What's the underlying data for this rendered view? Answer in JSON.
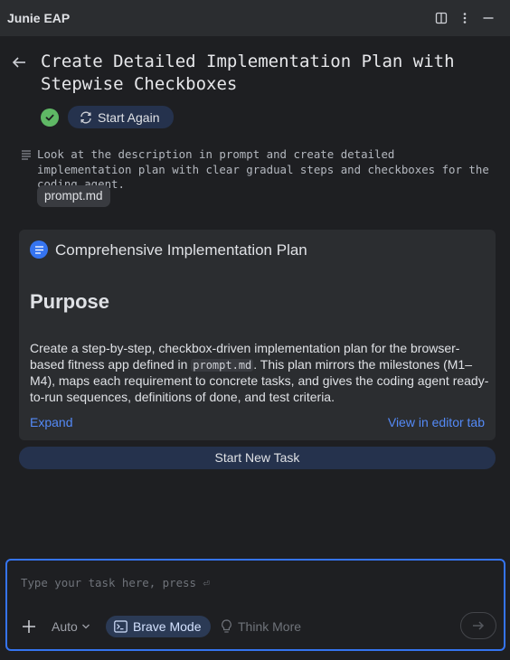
{
  "window": {
    "title": "Junie EAP",
    "icons": [
      "split-panel-icon",
      "more-vertical-icon",
      "minimize-icon"
    ]
  },
  "task": {
    "title": "Create Detailed Implementation Plan with Stepwise Checkboxes",
    "status_icon": "check-circle-icon",
    "start_again_label": "Start Again",
    "prompt_text": "Look at the description in prompt and create detailed implementation plan with clear gradual steps and checkboxes for the coding agent.",
    "attachment": "prompt.md"
  },
  "plan": {
    "title": "Comprehensive Implementation Plan",
    "heading": "Purpose",
    "body_before": "Create a step-by-step, checkbox-driven implementation plan for the browser-based fitness app defined in ",
    "body_code": "prompt.md",
    "body_after": ". This plan mirrors the milestones (M1–M4), maps each requirement to concrete tasks, and gives the coding agent ready-to-run sequences, definitions of done, and test criteria.",
    "expand_label": "Expand",
    "view_label": "View in editor tab"
  },
  "actions": {
    "new_task_label": "Start New Task"
  },
  "composer": {
    "placeholder": "Type your task here, press ⏎",
    "model": "Auto",
    "brave_mode_label": "Brave Mode",
    "think_more_label": "Think More"
  },
  "colors": {
    "background": "#1e1f22",
    "panel": "#2b2d30",
    "accent": "#3574f0",
    "link": "#548af7",
    "success": "#5fb865"
  }
}
